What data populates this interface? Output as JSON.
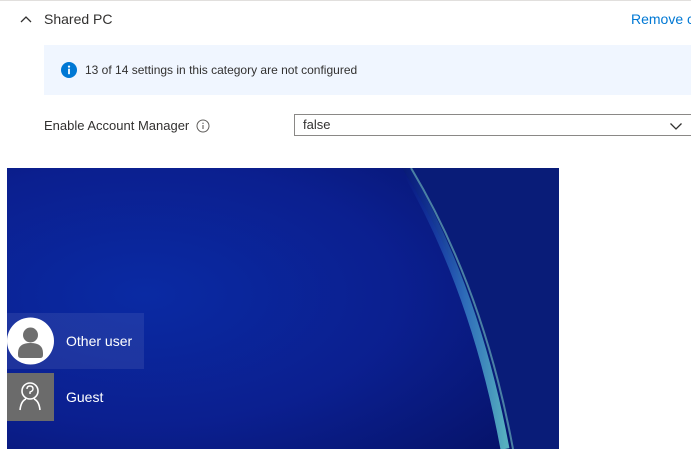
{
  "section": {
    "title": "Shared PC",
    "remove_label": "Remove c"
  },
  "info_bar": {
    "text": "13 of 14 settings in this category are not configured"
  },
  "setting": {
    "label": "Enable Account Manager",
    "value": "false"
  },
  "login_screen": {
    "users": [
      {
        "name": "Other user",
        "icon": "person-icon",
        "selected": true
      },
      {
        "name": "Guest",
        "icon": "guest-icon",
        "selected": false
      }
    ]
  },
  "colors": {
    "accent": "#0078d4",
    "info_background": "#f0f6ff",
    "login_background": "#0b1c86"
  }
}
